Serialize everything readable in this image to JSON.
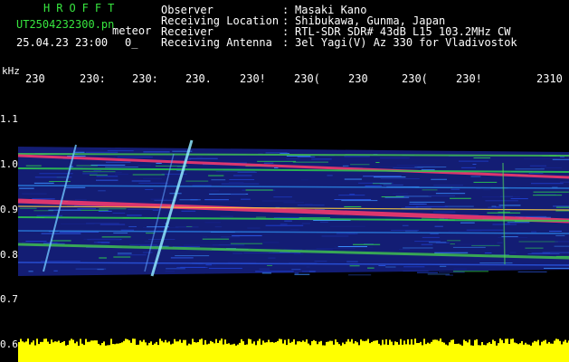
{
  "header": {
    "brand": "HROFFT",
    "filename": "UT2504232300.pn",
    "meteor_label": "meteor",
    "datetime": "25.04.23 23:00",
    "zero_mark": "0_"
  },
  "info": {
    "observer_label": "Observer",
    "observer_value": "Masaki Kano",
    "location_label": "Receiving Location",
    "location_value": "Shibukawa, Gunma, Japan",
    "receiver_label": "Receiver",
    "receiver_value": "RTL-SDR SDR# 43dB L15 103.2MHz CW",
    "antenna_label": "Receiving Antenna",
    "antenna_value": "3el Yagi(V) Az 330 for Vladivostok",
    "separator": ":"
  },
  "axis": {
    "unit": "kHz",
    "time_ticks": [
      "230",
      "230:",
      "230:",
      "230.",
      "230!",
      "230(",
      "230",
      "230(",
      "230!",
      "2310"
    ],
    "freq_ticks": [
      "1.1",
      "1.0",
      "0.9",
      "0.8",
      "0.7",
      "0.6"
    ]
  },
  "colors": {
    "background": "#000000",
    "header_green": "#37e63f",
    "signal_strong": "#ff3b6e",
    "signal_mid": "#2ecc50",
    "noise": "#1d2ea8",
    "level_bar": "#ffff00"
  }
}
